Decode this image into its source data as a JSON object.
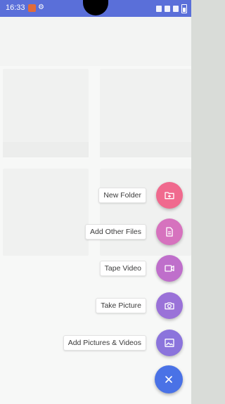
{
  "status_bar": {
    "time": "16:33",
    "icons": [
      "mute-icon",
      "signal-icon",
      "wifi-icon",
      "battery-icon"
    ]
  },
  "fab_menu": {
    "items": [
      {
        "label": "New Folder",
        "icon": "folder-add-icon",
        "color": "#f06a8e"
      },
      {
        "label": "Add Other Files",
        "icon": "file-icon",
        "color": "#d672be"
      },
      {
        "label": "Tape Video",
        "icon": "video-icon",
        "color": "#bf6fcb"
      },
      {
        "label": "Take Picture",
        "icon": "camera-icon",
        "color": "#9a72d8"
      },
      {
        "label": "Add Pictures & Videos",
        "icon": "image-icon",
        "color": "#8b74dc"
      }
    ],
    "close_icon": "close-icon",
    "close_color": "#4a72e6"
  },
  "colors": {
    "statusbar": "#5a6fd9",
    "scrim": "rgba(255,255,255,0.72)"
  }
}
